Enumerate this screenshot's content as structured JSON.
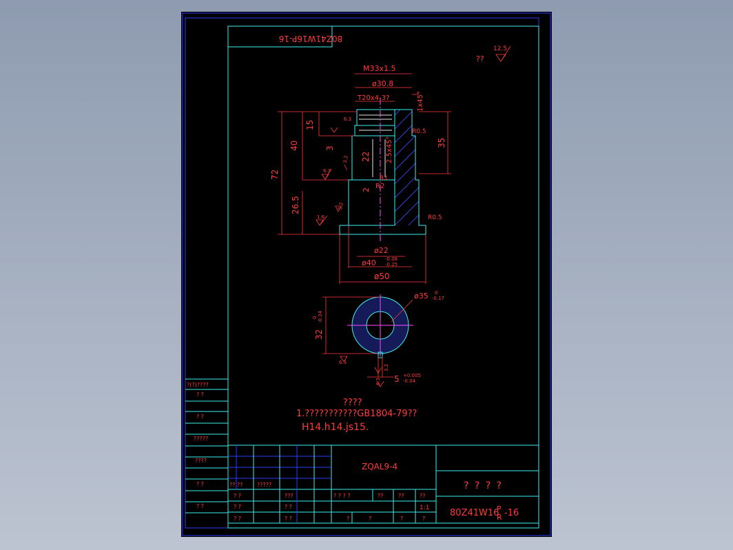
{
  "drawing": {
    "stamp_code": "80Z41W16P-16",
    "roughness_general": "12.5",
    "roughness_qq": "??",
    "dims": {
      "thread": "M33x1.5",
      "d308": "ø30.8",
      "trap": "T20x4-3?",
      "chamfer1": "1x45°",
      "r05a": "R0.5",
      "h15": "15",
      "h40": "40",
      "h72": "72",
      "h3": "3",
      "h22": "22",
      "chamfer2": "2.5x45°",
      "h35": "35",
      "h2": "2",
      "r2": "R2",
      "r1": "R1",
      "h265": "26.5",
      "r05b": "R0.5",
      "d22": "ø22",
      "d40": "ø40",
      "d40_up": "-0.08",
      "d40_lo": "-0.25",
      "d50": "ø50",
      "d35": "ø35",
      "d35_up": "0",
      "d35_lo": "-0.17",
      "h32": "32",
      "h32_up": "0",
      "h32_lo": "-0.34",
      "w5": "5",
      "w5_up": "+0.005",
      "w5_lo": "-0.04",
      "ra63a": "6.3",
      "ra63b": "6.3",
      "ra32": "3.2",
      "ra16": "1.6",
      "ra63c": "6.3",
      "ra32b": "3.2",
      "ra63d": "6.3",
      "ra32c": "3.2"
    },
    "notes": {
      "title": "????",
      "line1": "1.???????????GB1804-79??",
      "line2": "H14.h14.js15."
    },
    "left_table": [
      "?(?)????",
      "?   ?",
      "?   ?",
      "?????",
      "????",
      "?   ?",
      "?   ?"
    ],
    "title_block": {
      "material": "ZQAL9-4",
      "name": "? ? ? ?",
      "code_main": "80Z41W16",
      "code_p": "P",
      "code_r": "R",
      "code_tail": "-16",
      "scale": "1:1",
      "hdr_row": [
        "?? ??",
        "?????",
        "? ? ? ?",
        "??",
        "??",
        "??"
      ],
      "cells": [
        "? ?",
        "???",
        "? ?",
        "? ?",
        "? ?",
        "? ?",
        "?",
        "?",
        "?",
        "?"
      ]
    }
  }
}
